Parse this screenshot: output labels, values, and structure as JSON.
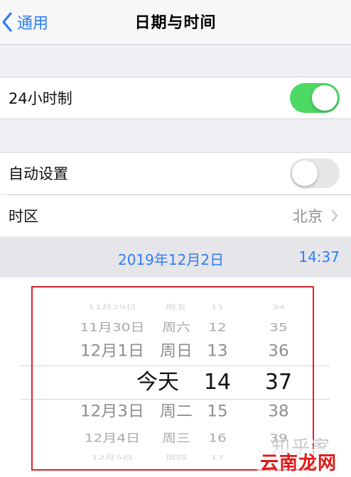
{
  "nav": {
    "back_label": "通用",
    "title": "日期与时间"
  },
  "settings": {
    "hour24": {
      "label": "24小时制",
      "enabled": true
    },
    "auto_set": {
      "label": "自动设置",
      "enabled": false
    },
    "timezone": {
      "label": "时区",
      "value": "北京"
    }
  },
  "datetime_bar": {
    "date": "2019年12月2日",
    "time": "14:37"
  },
  "picker": {
    "rows": [
      {
        "date": "11月29日",
        "weekday": "周五",
        "hour": "11",
        "minute": "34"
      },
      {
        "date": "11月30日",
        "weekday": "周六",
        "hour": "12",
        "minute": "35"
      },
      {
        "date": "12月1日",
        "weekday": "周日",
        "hour": "13",
        "minute": "36"
      },
      {
        "date": "",
        "weekday": "今天",
        "hour": "14",
        "minute": "37"
      },
      {
        "date": "12月3日",
        "weekday": "周二",
        "hour": "15",
        "minute": "38"
      },
      {
        "date": "12月4日",
        "weekday": "周三",
        "hour": "16",
        "minute": "39"
      },
      {
        "date": "12月5日",
        "weekday": "周四",
        "hour": "17",
        "minute": "40"
      }
    ]
  },
  "watermark": {
    "faint": "知乎家",
    "main": "云南龙网"
  },
  "colors": {
    "accent": "#2f7cf6",
    "toggle_on": "#4cd964",
    "annotation_box": "#d9262b"
  }
}
